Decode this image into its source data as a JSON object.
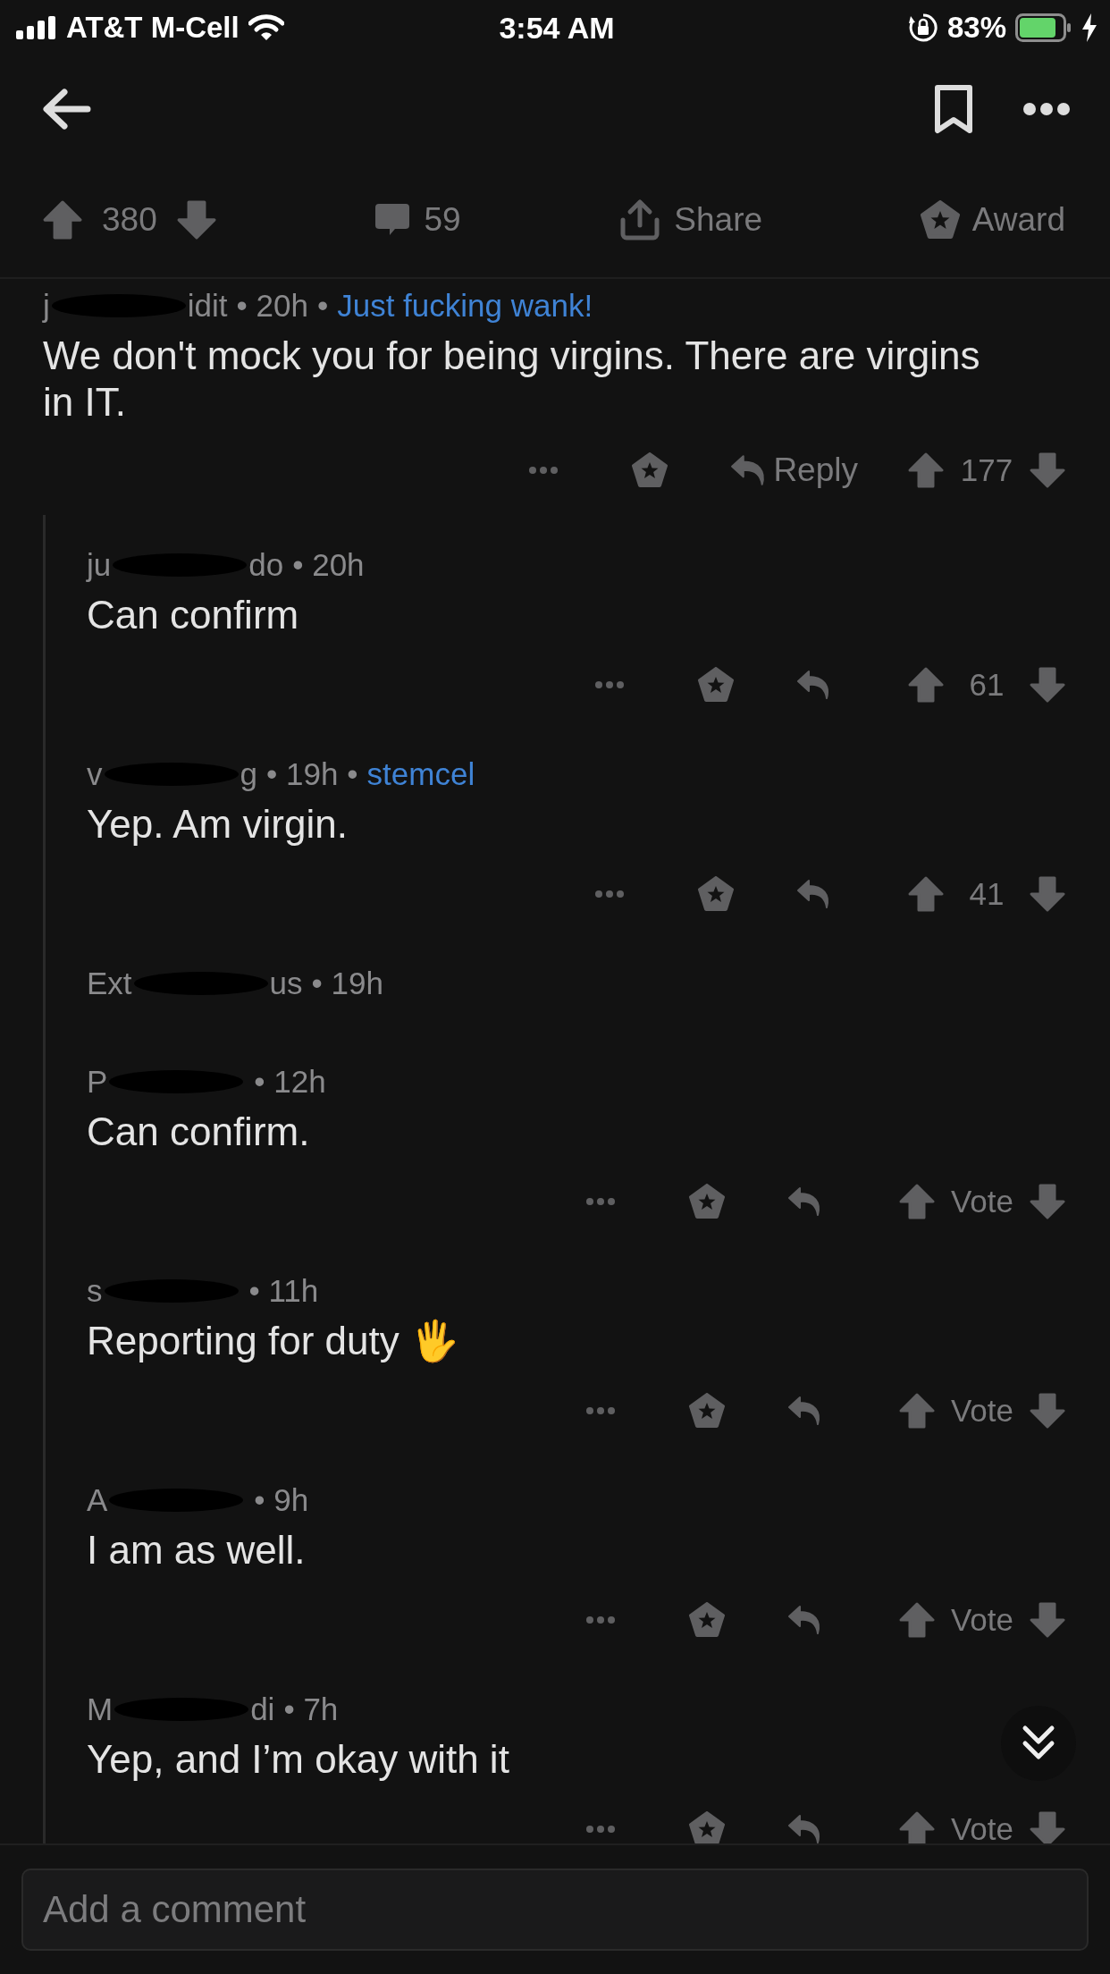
{
  "status_bar": {
    "carrier": "AT&T M-Cell",
    "time": "3:54 AM",
    "battery": "83%"
  },
  "post_actions": {
    "score": "380",
    "comments": "59",
    "share": "Share",
    "award": "Award"
  },
  "comments": [
    {
      "kind": "comment",
      "author_start": "j",
      "author_end": "idit",
      "age": "• 20h",
      "flair_dot": "•",
      "flair": "Just fucking wank!",
      "body": "We don't mock you for being virgins. There are virgins in IT.",
      "reply_label": "Reply",
      "score": "177",
      "children": [
        {
          "kind": "comment",
          "author_start": "ju",
          "author_end": "do",
          "age": "• 20h",
          "body": "Can confirm",
          "score": "61"
        },
        {
          "kind": "comment",
          "author_start": "v",
          "author_end": "g",
          "age": "• 19h",
          "flair_dot": "•",
          "flair": "stemcel",
          "body": "Yep. Am virgin.",
          "score": "41"
        },
        {
          "kind": "collapsed",
          "author_start": "Ext",
          "author_end": "us",
          "age": "• 19h"
        },
        {
          "kind": "comment",
          "author_start": "P",
          "age": "• 12h",
          "body": "Can confirm.",
          "score": "Vote"
        },
        {
          "kind": "comment",
          "author_start": "s",
          "age": "• 11h",
          "body": "Reporting for duty 🖐",
          "score": "Vote"
        },
        {
          "kind": "comment",
          "author_start": "A",
          "age": "• 9h",
          "body": "I am as well.",
          "score": "Vote"
        },
        {
          "kind": "comment",
          "author_start": "M",
          "author_end": "di",
          "age": "• 7h",
          "body": "Yep, and I’m okay with it",
          "score": "Vote"
        }
      ]
    }
  ],
  "comment_field": {
    "placeholder": "Add a comment"
  }
}
